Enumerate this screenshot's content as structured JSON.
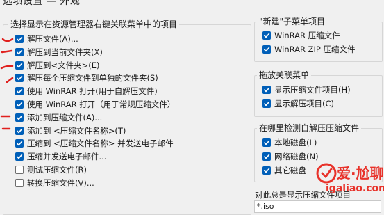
{
  "window": {
    "title_fragment": "选项设置 — 外观"
  },
  "left_group": {
    "title": "选择显示在资源管理器右键关联菜单中的项目",
    "items": [
      {
        "label": "解压文件(A)...",
        "checked": true
      },
      {
        "label": "解压到当前文件夹(X)",
        "checked": true
      },
      {
        "label": "解压到<文件夹>(E)",
        "checked": true
      },
      {
        "label": "解压每个压缩文件到单独的文件夹(S)",
        "checked": true
      },
      {
        "label": "使用 WinRAR 打开(用于自解压文件)",
        "checked": true
      },
      {
        "label": "使用 WinRAR 打开（用于常规压缩文件）",
        "checked": true
      },
      {
        "label": "添加到压缩文件(A)...",
        "checked": true
      },
      {
        "label": "添加到 <压缩文件名称>(T)",
        "checked": true
      },
      {
        "label": "压缩到 <压缩文件名称> 并发送电子邮件",
        "checked": true
      },
      {
        "label": "压缩并发送电子邮件...",
        "checked": true
      },
      {
        "label": "测试压缩文件(R)",
        "checked": false
      },
      {
        "label": "转换压缩文件(V)...",
        "checked": false
      }
    ]
  },
  "new_submenu_group": {
    "title": "\"新建\"子菜单项目",
    "items": [
      {
        "label": "WinRAR 压缩文件",
        "checked": true
      },
      {
        "label": "WinRAR ZIP 压缩文件",
        "checked": true
      }
    ]
  },
  "drag_menu_group": {
    "title": "拖放关联菜单",
    "items": [
      {
        "label": "显示压缩文件项目(H)",
        "checked": true
      },
      {
        "label": "显示解压项目(C)",
        "checked": true
      }
    ]
  },
  "sfx_detect_group": {
    "title": "在哪里检测自解压压缩文件",
    "items": [
      {
        "label": "本地磁盘(L)",
        "checked": true
      },
      {
        "label": "网络磁盘(N)",
        "checked": true
      },
      {
        "label": "其它磁盘",
        "checked": true
      }
    ]
  },
  "bottom_right": {
    "label": "对此总是显示压缩文件项目",
    "value": "*.iso"
  },
  "watermark": {
    "text": "爱·尬聊",
    "url": "igaliao.com"
  },
  "colors": {
    "checkbox_accent": "#005fb8",
    "annotation_red": "#e0201e",
    "watermark_red": "#e8322a"
  }
}
